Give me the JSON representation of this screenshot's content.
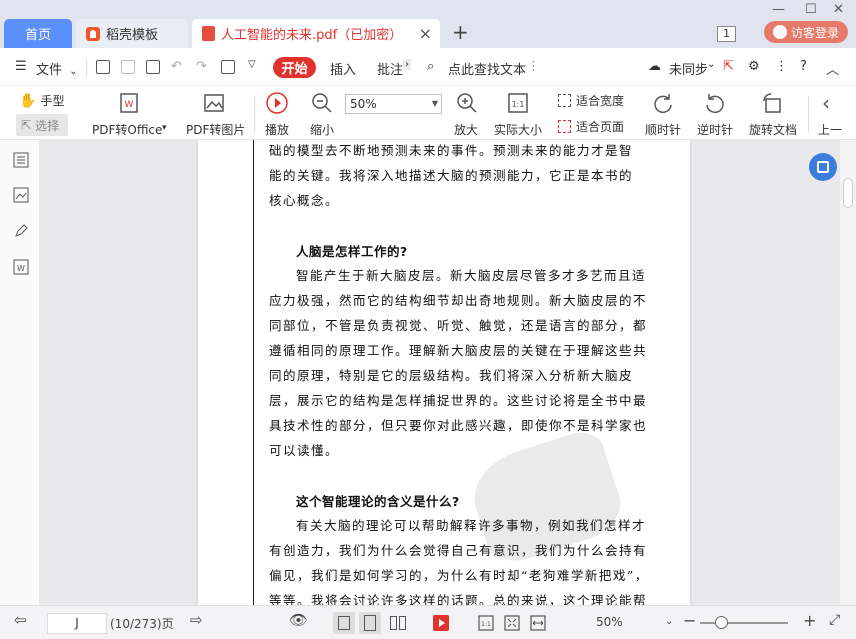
{
  "tabs": {
    "home": "首页",
    "template": "稻壳模板",
    "document": "人工智能的未来.pdf（已加密）"
  },
  "window": {
    "counter": "1",
    "login": "访客登录"
  },
  "menu": {
    "file": "文件",
    "start": "开始",
    "insert": "插入",
    "annotate": "批注",
    "search_placeholder": "点此查找文本",
    "sync": "未同步"
  },
  "toolbar": {
    "hand": "手型",
    "select": "选择",
    "pdf_to_office": "PDF转Office",
    "pdf_to_image": "PDF转图片",
    "play": "播放",
    "zoom_out": "缩小",
    "zoom_value": "50%",
    "zoom_in": "放大",
    "actual_size": "实际大小",
    "fit_width": "适合宽度",
    "fit_page": "适合页面",
    "rotate_cw": "顺时针",
    "rotate_ccw": "逆时针",
    "rotate_doc": "旋转文档",
    "prev": "上一"
  },
  "document": {
    "lines_top": [
      "础的模型去不断地预测未来的事件。预测未来的能力才是智",
      "能的关键。我将深入地描述大脑的预测能力，它正是本书的",
      "核心概念。"
    ],
    "heading1": "人脑是怎样工作的?",
    "section1": [
      "智能产生于新大脑皮层。新大脑皮层尽管多才多艺而且适",
      "应力极强，然而它的结构细节却出奇地规则。新大脑皮层的不",
      "同部位，不管是负责视觉、听觉、触觉，还是语言的部分，都",
      "遵循相同的原理工作。理解新大脑皮层的关键在于理解这些共",
      "同的原理，特别是它的层级结构。我们将深入分析新大脑皮",
      "层，展示它的结构是怎样捕捉世界的。这些讨论将是全书中最",
      "具技术性的部分，但只要你对此感兴趣，即使你不是科学家也",
      "可以读懂。"
    ],
    "heading2": "这个智能理论的含义是什么?",
    "section2": [
      "有关大脑的理论可以帮助解释许多事物，例如我们怎样才",
      "有创造力，我们为什么会觉得自己有意识，我们为什么会持有",
      "偏见，我们是如何学习的，为什么有时却“老狗难学新把戏”，",
      "等等。我将会讨论许多这样的话题。总的来说，这个理论能帮"
    ]
  },
  "status": {
    "page_input": "J",
    "page_count": "(10/273)页",
    "zoom": "50%"
  },
  "colors": {
    "accent": "#e0332d",
    "home_tab": "#5b8ff9"
  }
}
